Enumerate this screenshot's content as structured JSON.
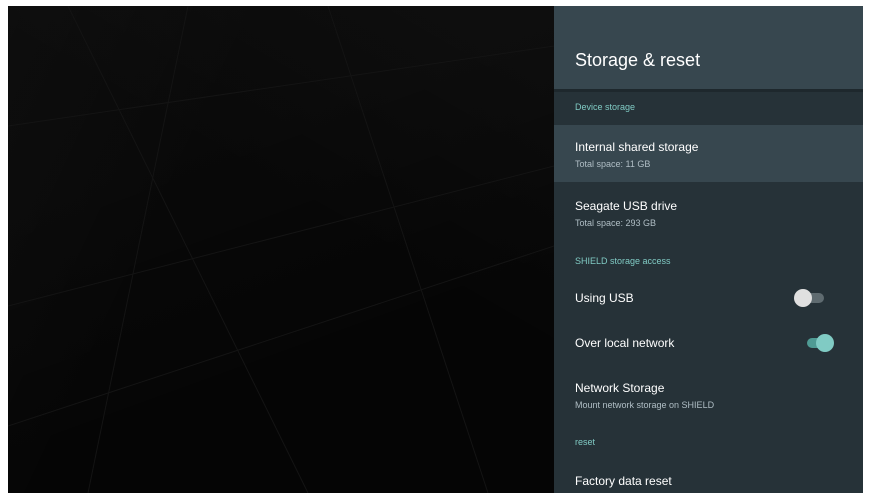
{
  "panel": {
    "title": "Storage & reset"
  },
  "sections": {
    "device_storage": "Device storage",
    "shield_access": "SHIELD storage access",
    "reset": "reset"
  },
  "items": {
    "internal": {
      "title": "Internal shared storage",
      "subtitle": "Total space: 11 GB"
    },
    "usb_drive": {
      "title": "Seagate USB drive",
      "subtitle": "Total space: 293 GB"
    },
    "using_usb": {
      "title": "Using USB",
      "toggle": "off"
    },
    "local_network": {
      "title": "Over local network",
      "toggle": "on"
    },
    "network_storage": {
      "title": "Network Storage",
      "subtitle": "Mount network storage on SHIELD"
    },
    "factory_reset": {
      "title": "Factory data reset"
    }
  },
  "colors": {
    "panel_bg": "#263238",
    "header_bg": "#37474f",
    "accent": "#80cbc4"
  }
}
